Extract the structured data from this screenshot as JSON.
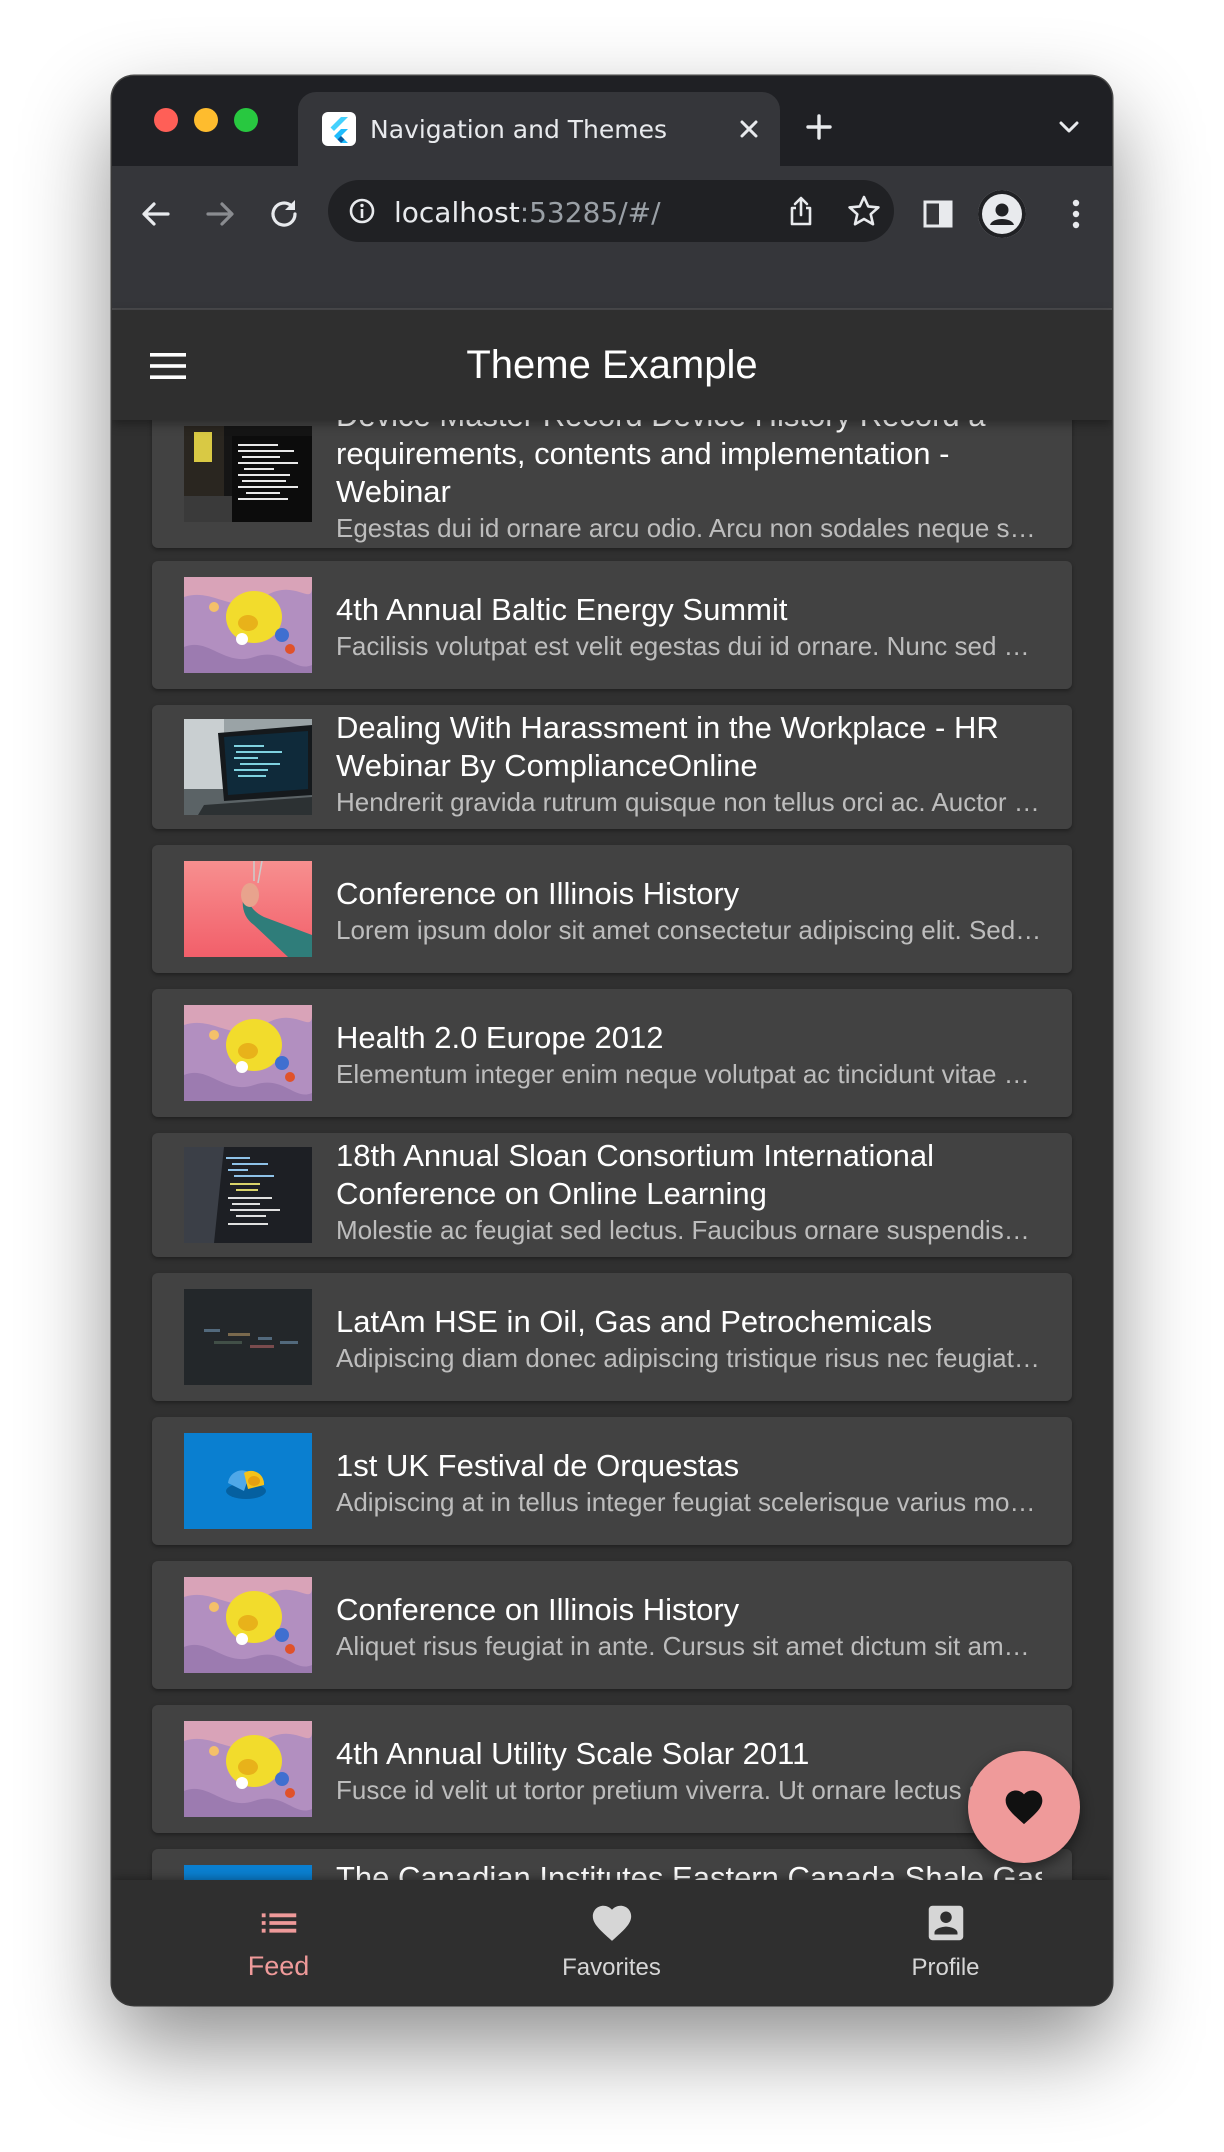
{
  "browser": {
    "tab_title": "Navigation and Themes",
    "url_host": "localhost",
    "url_rest": ":53285/#/"
  },
  "app": {
    "title": "Theme Example"
  },
  "feed": [
    {
      "title": "Device Master Record Device History Record a requirements, contents and implementation - Webinar",
      "subtitle": "Egestas dui id ornare arcu odio. Arcu non sodales neque sodales ut etiam sit.",
      "thumb": "monitor-code"
    },
    {
      "title": "4th Annual Baltic Energy Summit",
      "subtitle": "Facilisis volutpat est velit egestas dui id ornare. Nunc sed blandit.",
      "thumb": "paint"
    },
    {
      "title": "Dealing With Harassment in the Workplace - HR Webinar By ComplianceOnline",
      "subtitle": "Hendrerit gravida rutrum quisque non tellus orci ac. Auctor augue.",
      "thumb": "laptop"
    },
    {
      "title": "Conference on Illinois History",
      "subtitle": "Lorem ipsum dolor sit amet consectetur adipiscing elit. Sed do eiusmod.",
      "thumb": "hand-pink"
    },
    {
      "title": "Health 2.0 Europe 2012",
      "subtitle": "Elementum integer enim neque volutpat ac tincidunt vitae semper quis.",
      "thumb": "paint"
    },
    {
      "title": "18th Annual Sloan Consortium International Conference on Online Learning",
      "subtitle": "Molestie ac feugiat sed lectus. Faucibus ornare suspendisse sed nisi.",
      "thumb": "code-dark"
    },
    {
      "title": "LatAm HSE in Oil, Gas and Petrochemicals",
      "subtitle": "Adipiscing diam donec adipiscing tristique risus nec feugiat in fermentum.",
      "thumb": "code-blur"
    },
    {
      "title": "1st UK Festival de Orquestas",
      "subtitle": "Adipiscing at in tellus integer feugiat scelerisque varius morbi enim.",
      "thumb": "blue-pill"
    },
    {
      "title": "Conference on Illinois History",
      "subtitle": "Aliquet risus feugiat in ante. Cursus sit amet dictum sit amet justo.",
      "thumb": "paint"
    },
    {
      "title": "4th Annual Utility Scale Solar 2011",
      "subtitle": "Fusce id velit ut tortor pretium viverra. Ut ornare lectus sit amet est.",
      "thumb": "paint"
    },
    {
      "title": "The Canadian Institutes Eastern Canada Shale Gas",
      "subtitle": "",
      "thumb": "blue-pill"
    }
  ],
  "bottom_nav": [
    {
      "label": "Feed",
      "icon": "list-icon",
      "active": true
    },
    {
      "label": "Favorites",
      "icon": "heart-icon",
      "active": false
    },
    {
      "label": "Profile",
      "icon": "account-box-icon",
      "active": false
    }
  ],
  "fab": {
    "icon": "heart-icon"
  },
  "colors": {
    "accent": "#ef9a9a",
    "card": "#424242",
    "background": "#303030",
    "appbar": "#2f2f2f"
  }
}
